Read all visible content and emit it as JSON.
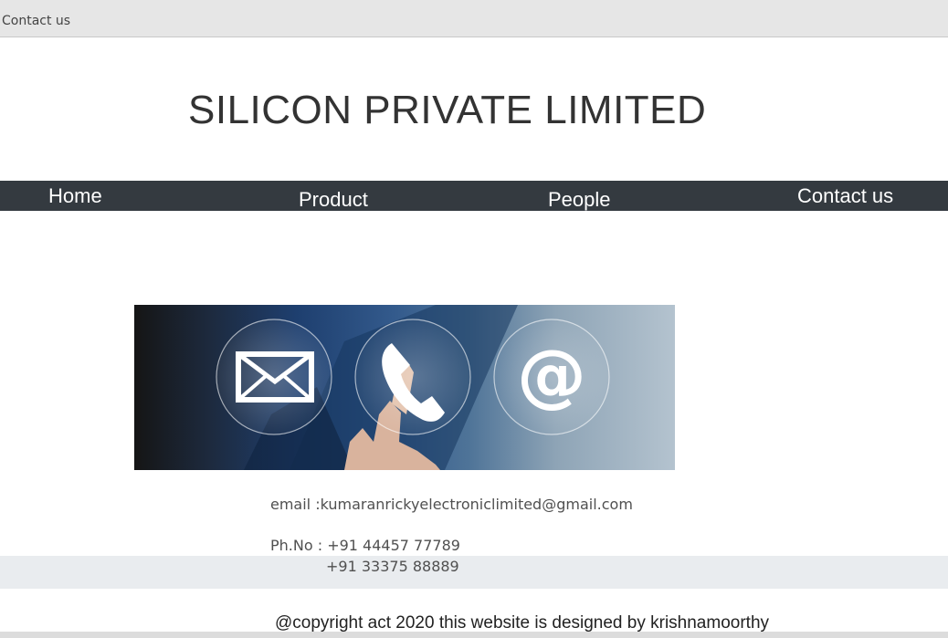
{
  "browser": {
    "tab_title": "Contact us"
  },
  "header": {
    "site_title": "SILICON PRIVATE LIMITED"
  },
  "nav": {
    "items": [
      {
        "label": "Home"
      },
      {
        "label": "Product"
      },
      {
        "label": "People"
      },
      {
        "label": "Contact us"
      }
    ]
  },
  "banner": {
    "icons": [
      "envelope-icon",
      "phone-icon",
      "at-sign-icon"
    ],
    "at_symbol": "@"
  },
  "contact": {
    "email": "email :kumaranrickyelectroniclimited@gmail.com",
    "phone_line1": "Ph.No : +91 44457 77789",
    "phone_line2": "+91 33375 88889"
  },
  "footer": {
    "copyright": "@copyright act 2020 this website is designed by krishnamoorthy"
  },
  "colors": {
    "navbar": "#343a40",
    "tabbar": "#e6e6e6",
    "band": "#e9ecef"
  }
}
